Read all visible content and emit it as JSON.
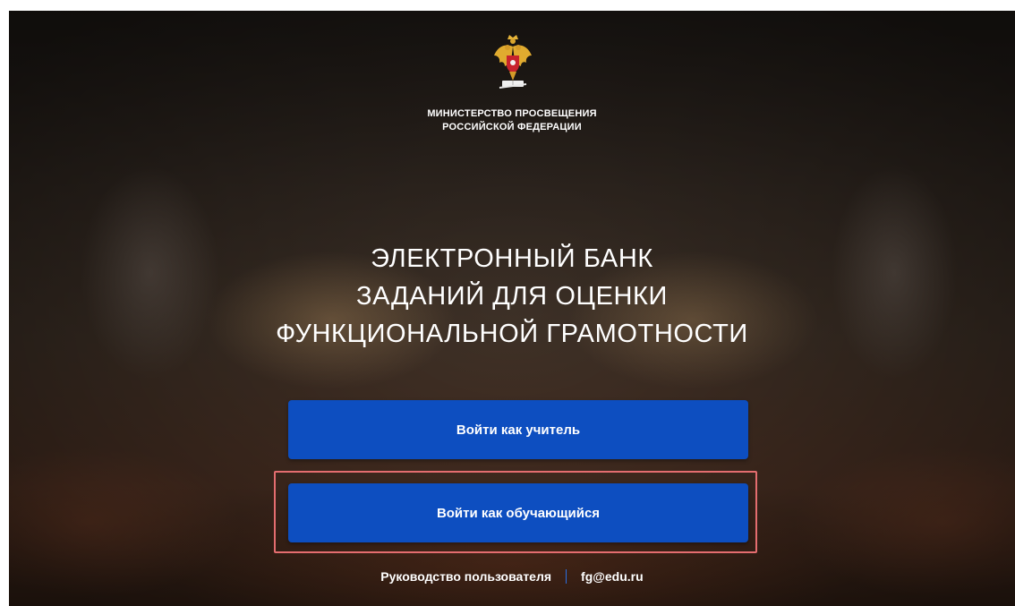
{
  "header": {
    "ministry_line1": "МИНИСТЕРСТВО ПРОСВЕЩЕНИЯ",
    "ministry_line2": "РОССИЙСКОЙ ФЕДЕРАЦИИ",
    "emblem_icon": "coat-of-arms-icon"
  },
  "title": {
    "line1": "ЭЛЕКТРОННЫЙ БАНК",
    "line2": "ЗАДАНИЙ ДЛЯ ОЦЕНКИ",
    "line3": "ФУНКЦИОНАЛЬНОЙ ГРАМОТНОСТИ"
  },
  "buttons": {
    "teacher_label": "Войти как учитель",
    "student_label": "Войти как обучающийся"
  },
  "footer": {
    "manual_link": "Руководство пользователя",
    "email_link": "fg@edu.ru"
  },
  "colors": {
    "button": "#0d4ec0",
    "highlight": "#e46d6f",
    "separator": "#2b6fe0"
  }
}
